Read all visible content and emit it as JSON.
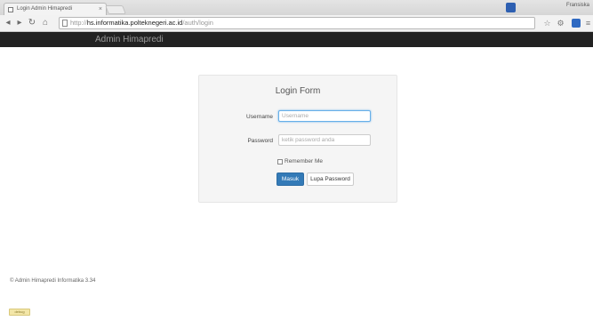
{
  "browser": {
    "tab_title": "Login Admin Himapredi",
    "tab_close": "×",
    "profile_label": "Fransiska",
    "url_scheme": "http://",
    "url_host": "hs.informatika.polteknegeri.ac.id",
    "url_path": "/auth/login",
    "nav": {
      "back": "◂",
      "forward": "▸",
      "reload": "↻",
      "home": "⌂"
    },
    "right_icons": [
      "☆",
      "⚙",
      "≡"
    ]
  },
  "navbar": {
    "brand": "Admin Himapredi"
  },
  "login": {
    "title": "Login Form",
    "username_label": "Username",
    "username_placeholder": "Username",
    "password_label": "Password",
    "password_placeholder": "ketik password anda",
    "remember_label": "Remember Me",
    "submit_label": "Masuk",
    "forgot_label": "Lupa Password"
  },
  "footer": {
    "copyright": "© Admin Himapredi Informatika 3.34",
    "badge": "debug"
  },
  "colors": {
    "navbar_bg": "#222222",
    "primary_button": "#337ab7",
    "card_bg": "#f5f5f5"
  }
}
